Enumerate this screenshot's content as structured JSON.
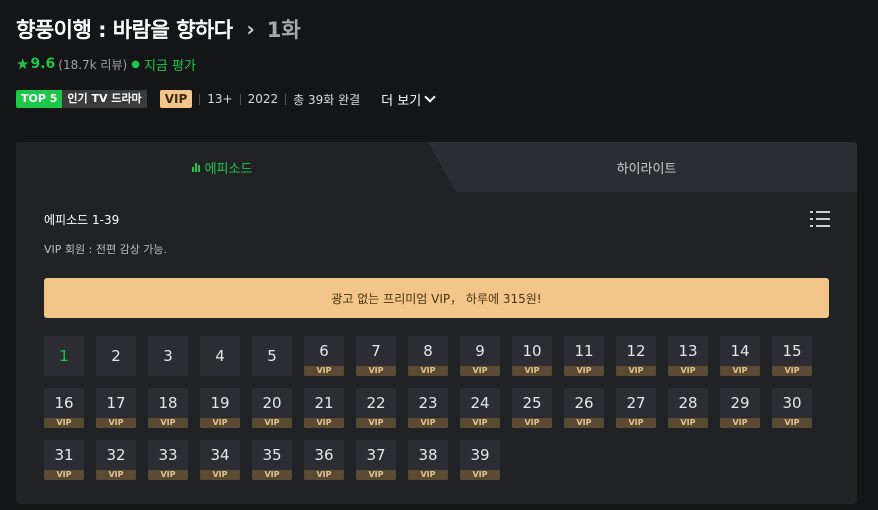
{
  "header": {
    "show_title": "향풍이행 : 바람을 향하다",
    "separator": "›",
    "episode_title": "1화"
  },
  "rating": {
    "score": "9.6",
    "reviews": "(18.7k 리뷰)",
    "rate_now": "지금 평가"
  },
  "tags": {
    "top5_label": "TOP 5",
    "top5_text": "인기 TV 드라마",
    "vip": "VIP",
    "age": "13+",
    "year": "2022",
    "episodes": "총 39화 완결",
    "more": "더 보기"
  },
  "tabs": {
    "episodes": "에피소드",
    "highlights": "하이라이트"
  },
  "episode_section": {
    "range_label": "에피소드 1-39",
    "vip_note": "VIP 회원 : 전편 감상 가능.",
    "promo": "광고 없는 프리미엄 VIP， 하루에 315원!",
    "vip_tag": "VIP",
    "current_episode": 1,
    "episodes": [
      {
        "n": "1",
        "vip": false
      },
      {
        "n": "2",
        "vip": false
      },
      {
        "n": "3",
        "vip": false
      },
      {
        "n": "4",
        "vip": false
      },
      {
        "n": "5",
        "vip": false
      },
      {
        "n": "6",
        "vip": true
      },
      {
        "n": "7",
        "vip": true
      },
      {
        "n": "8",
        "vip": true
      },
      {
        "n": "9",
        "vip": true
      },
      {
        "n": "10",
        "vip": true
      },
      {
        "n": "11",
        "vip": true
      },
      {
        "n": "12",
        "vip": true
      },
      {
        "n": "13",
        "vip": true
      },
      {
        "n": "14",
        "vip": true
      },
      {
        "n": "15",
        "vip": true
      },
      {
        "n": "16",
        "vip": true
      },
      {
        "n": "17",
        "vip": true
      },
      {
        "n": "18",
        "vip": true
      },
      {
        "n": "19",
        "vip": true
      },
      {
        "n": "20",
        "vip": true
      },
      {
        "n": "21",
        "vip": true
      },
      {
        "n": "22",
        "vip": true
      },
      {
        "n": "23",
        "vip": true
      },
      {
        "n": "24",
        "vip": true
      },
      {
        "n": "25",
        "vip": true
      },
      {
        "n": "26",
        "vip": true
      },
      {
        "n": "27",
        "vip": true
      },
      {
        "n": "28",
        "vip": true
      },
      {
        "n": "29",
        "vip": true
      },
      {
        "n": "30",
        "vip": true
      },
      {
        "n": "31",
        "vip": true
      },
      {
        "n": "32",
        "vip": true
      },
      {
        "n": "33",
        "vip": true
      },
      {
        "n": "34",
        "vip": true
      },
      {
        "n": "35",
        "vip": true
      },
      {
        "n": "36",
        "vip": true
      },
      {
        "n": "37",
        "vip": true
      },
      {
        "n": "38",
        "vip": true
      },
      {
        "n": "39",
        "vip": true
      }
    ]
  },
  "colors": {
    "accent": "#1cc749",
    "vip_gold": "#f2c589",
    "background": "#141517",
    "panel": "#212226"
  },
  "icons": {
    "star": "star-icon",
    "more": "chevron-down-icon",
    "episodes_tab": "bar-chart-icon",
    "list": "list-icon"
  }
}
